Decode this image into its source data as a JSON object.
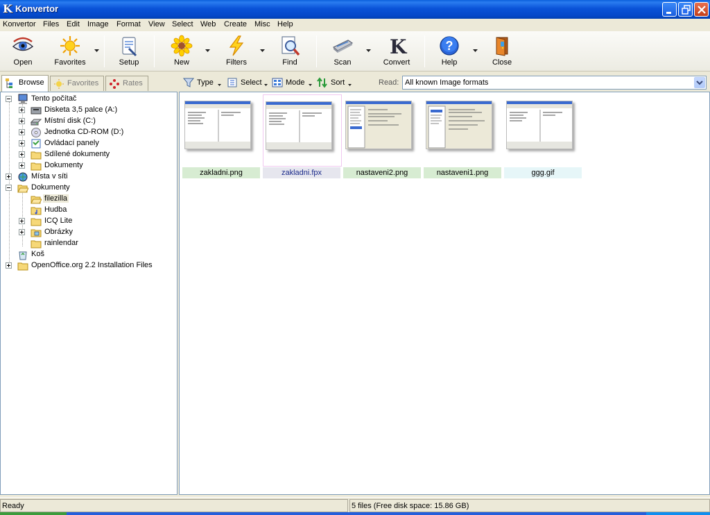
{
  "window": {
    "title": "Konvertor"
  },
  "menu": [
    "Konvertor",
    "Files",
    "Edit",
    "Image",
    "Format",
    "View",
    "Select",
    "Web",
    "Create",
    "Misc",
    "Help"
  ],
  "toolbar": {
    "open": "Open",
    "favorites": "Favorites",
    "setup": "Setup",
    "new": "New",
    "filters": "Filters",
    "find": "Find",
    "scan": "Scan",
    "convert": "Convert",
    "help": "Help",
    "close": "Close"
  },
  "left_tabs": {
    "browse": "Browse",
    "favorites": "Favorites",
    "rates": "Rates"
  },
  "tree": [
    "Tento počítač",
    "Disketa 3,5 palce (A:)",
    "Místní disk (C:)",
    "Jednotka CD-ROM (D:)",
    "Ovládací panely",
    "Sdílené dokumenty",
    "Dokumenty",
    "Místa v síti",
    "Dokumenty",
    "filezilla",
    "Hudba",
    "ICQ Lite",
    "Obrázky",
    "rainlendar",
    "Koš",
    "OpenOffice.org 2.2 Installation Files"
  ],
  "right_toolbar": {
    "type": "Type",
    "select": "Select",
    "mode": "Mode",
    "sort": "Sort",
    "read_label": "Read:",
    "read_value": "All known Image formats"
  },
  "files": [
    {
      "name": "zakladni.png",
      "bg": "#d7ecd2",
      "color": "#000000"
    },
    {
      "name": "zakladni.fpx",
      "bg": "#e6e6ee",
      "color": "#1a2a8a"
    },
    {
      "name": "nastaveni2.png",
      "bg": "#d7ecd2",
      "color": "#000000"
    },
    {
      "name": "nastaveni1.png",
      "bg": "#d7ecd2",
      "color": "#000000"
    },
    {
      "name": "ggg.gif",
      "bg": "#e6f6f8",
      "color": "#000000"
    }
  ],
  "status": {
    "left": "Ready",
    "right": "5 files  (Free disk space: 15.86 GB)"
  }
}
